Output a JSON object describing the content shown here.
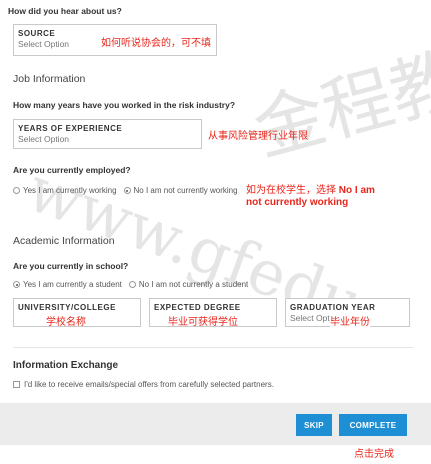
{
  "hear_about": {
    "question": "How did you hear about us?",
    "caption": "SOURCE",
    "placeholder": "Select Option",
    "note": "如何听说协会的，可不填"
  },
  "job": {
    "heading": "Job Information",
    "years_question": "How many years have you worked in the risk industry?",
    "years_caption": "YEARS OF EXPERIENCE",
    "years_placeholder": "Select Option",
    "years_note": "从事风险管理行业年限",
    "employed_question": "Are you currently employed?",
    "employed_options": [
      "Yes I am currently working",
      "No I am not currently working"
    ],
    "employed_selected": 1,
    "employed_note_line1": "如为在校学生，选择 ",
    "employed_note_en1": "No I am",
    "employed_note_line2": "not currently working"
  },
  "academic": {
    "heading": "Academic Information",
    "school_question": "Are you currently in school?",
    "school_options": [
      "Yes I am currently a student",
      "No I am not currently a student"
    ],
    "school_selected": 0,
    "university_caption": "UNIVERSITY/COLLEGE",
    "university_note": "学校名称",
    "degree_caption": "EXPECTED DEGREE",
    "degree_note": "毕业可获得学位",
    "grad_caption": "GRADUATION YEAR",
    "grad_placeholder": "Select Option",
    "grad_note": "毕业年份"
  },
  "info_exchange": {
    "heading": "Information Exchange",
    "consent_label": "I'd like to receive emails/special offers from carefully selected partners."
  },
  "footer": {
    "skip_label": "SKIP",
    "complete_label": "COMPLETE",
    "complete_note": "点击完成"
  },
  "colors": {
    "accent": "#1e8fd5",
    "annotation": "#e8261c"
  }
}
